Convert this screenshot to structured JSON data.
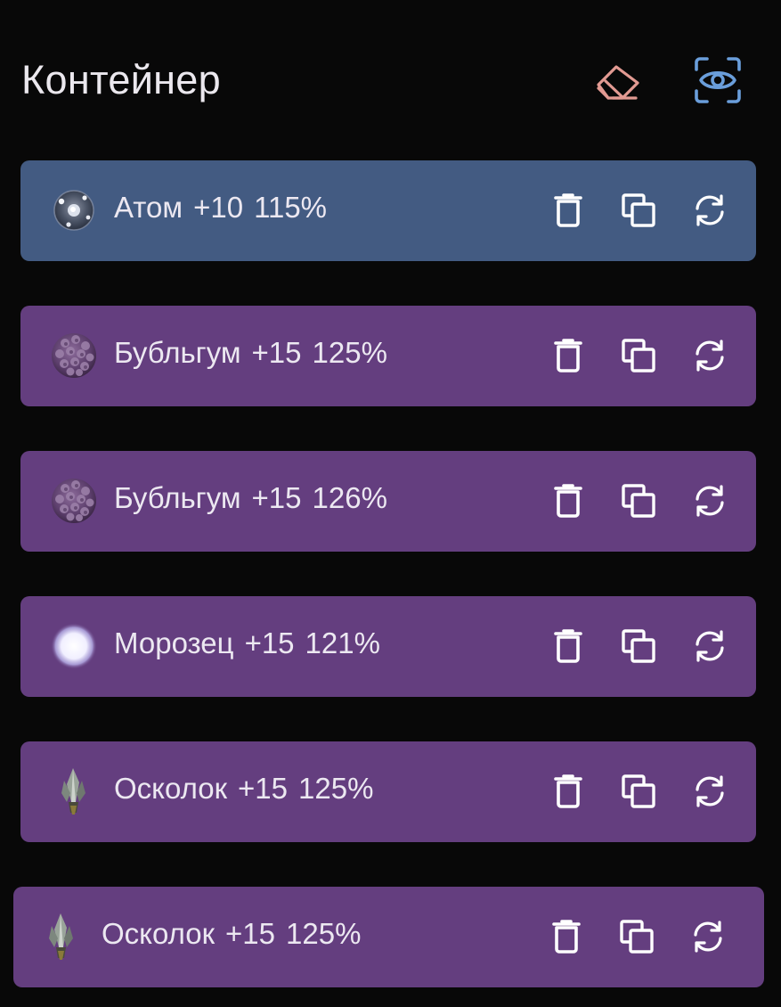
{
  "header": {
    "title": "Контейнер",
    "eraser_icon": "eraser-icon",
    "eye_icon": "eye-scan-icon"
  },
  "colors": {
    "background": "#080808",
    "row_selected": "#435b82",
    "row_default": "#643e7f",
    "eraser": "#e29a92",
    "eye": "#6a9edb"
  },
  "items": [
    {
      "name": "Атом",
      "level": "+10",
      "percent": "115%",
      "icon": "atom-icon",
      "selected": true
    },
    {
      "name": "Бубльгум",
      "level": "+15",
      "percent": "125%",
      "icon": "bubblegum-icon",
      "selected": false
    },
    {
      "name": "Бубльгум",
      "level": "+15",
      "percent": "126%",
      "icon": "bubblegum-icon",
      "selected": false
    },
    {
      "name": "Морозец",
      "level": "+15",
      "percent": "121%",
      "icon": "frost-icon",
      "selected": false
    },
    {
      "name": "Осколок",
      "level": "+15",
      "percent": "125%",
      "icon": "shard-icon",
      "selected": false
    },
    {
      "name": "Осколок",
      "level": "+15",
      "percent": "125%",
      "icon": "shard-icon",
      "selected": false
    }
  ],
  "actions": {
    "delete_icon": "trash-icon",
    "duplicate_icon": "copy-icon",
    "swap_icon": "refresh-icon"
  }
}
